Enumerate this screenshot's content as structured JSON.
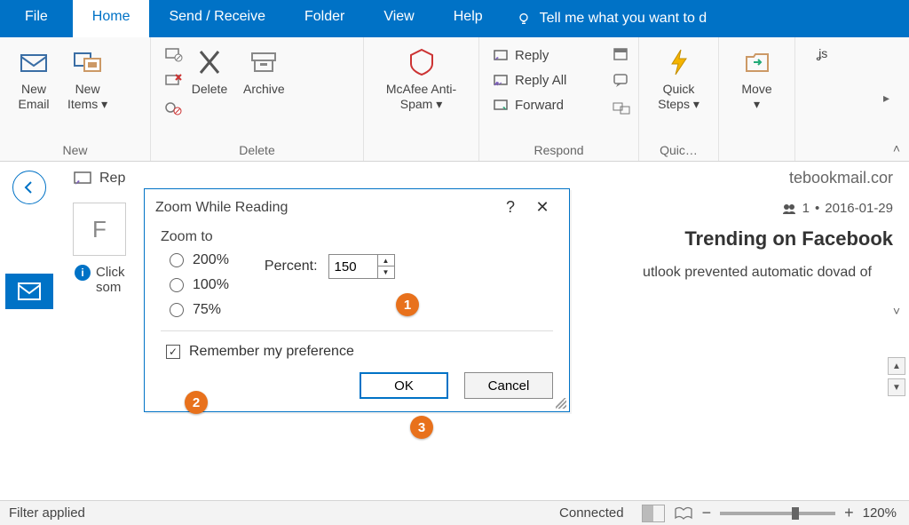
{
  "tabs": {
    "file": "File",
    "home": "Home",
    "send_receive": "Send / Receive",
    "folder": "Folder",
    "view": "View",
    "help": "Help",
    "tellme": "Tell me what you want to d"
  },
  "ribbon": {
    "new": {
      "label": "New",
      "new_email": "New\nEmail",
      "new_items": "New\nItems ▾"
    },
    "delete": {
      "label": "Delete",
      "delete": "Delete",
      "archive": "Archive"
    },
    "mcafee": "McAfee Anti-\nSpam ▾",
    "respond": {
      "label": "Respond",
      "reply": "Reply",
      "reply_all": "Reply All",
      "forward": "Forward"
    },
    "quicksteps": {
      "label": "Quic…",
      "btn": "Quick\nSteps ▾"
    },
    "move": {
      "btn": "Move\n▾"
    },
    "tags": {
      "btn": "ʝs"
    }
  },
  "reading": {
    "reply_snip": "Rep",
    "avatar_initial": "F",
    "from_tail": "tebookmail.cor",
    "recipients_count": "1",
    "date": "2016-01-29",
    "subject_tail": "Trending on Facebook",
    "click_text_1": "Click",
    "click_text_2": "som",
    "blocked_tail": "utlook prevented automatic dovad of"
  },
  "dialog": {
    "title": "Zoom While Reading",
    "zoom_to": "Zoom to",
    "opt_200": "200%",
    "opt_100": "100%",
    "opt_75": "75%",
    "percent_label": "Percent:",
    "percent_value": "150",
    "remember": "Remember my preference",
    "ok": "OK",
    "cancel": "Cancel"
  },
  "callouts": {
    "c1": "1",
    "c2": "2",
    "c3": "3"
  },
  "status": {
    "filter": "Filter applied",
    "connected": "Connected",
    "zoom": "120%"
  }
}
